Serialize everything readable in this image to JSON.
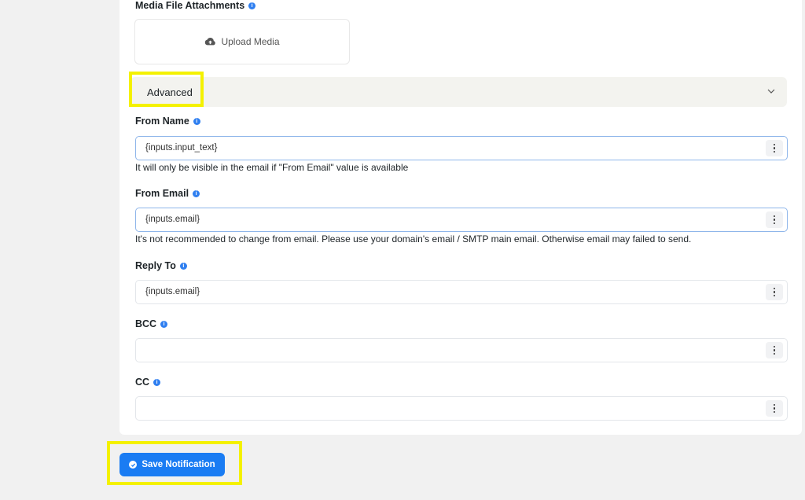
{
  "media": {
    "label": "Media File Attachments",
    "upload_label": "Upload Media"
  },
  "advanced": {
    "title": "Advanced"
  },
  "fields": {
    "from_name": {
      "label": "From Name",
      "value": "{inputs.input_text}",
      "help": "It will only be visible in the email if \"From Email\" value is available"
    },
    "from_email": {
      "label": "From Email",
      "value": "{inputs.email}",
      "help": "It's not recommended to change from email. Please use your domain's email / SMTP main email. Otherwise email may failed to send."
    },
    "reply_to": {
      "label": "Reply To",
      "value": "{inputs.email}"
    },
    "bcc": {
      "label": "BCC",
      "value": ""
    },
    "cc": {
      "label": "CC",
      "value": ""
    }
  },
  "actions": {
    "save_label": "Save Notification"
  },
  "colors": {
    "accent": "#1a7cf3",
    "highlight": "#f4f100",
    "info": "#2f7ff0"
  }
}
